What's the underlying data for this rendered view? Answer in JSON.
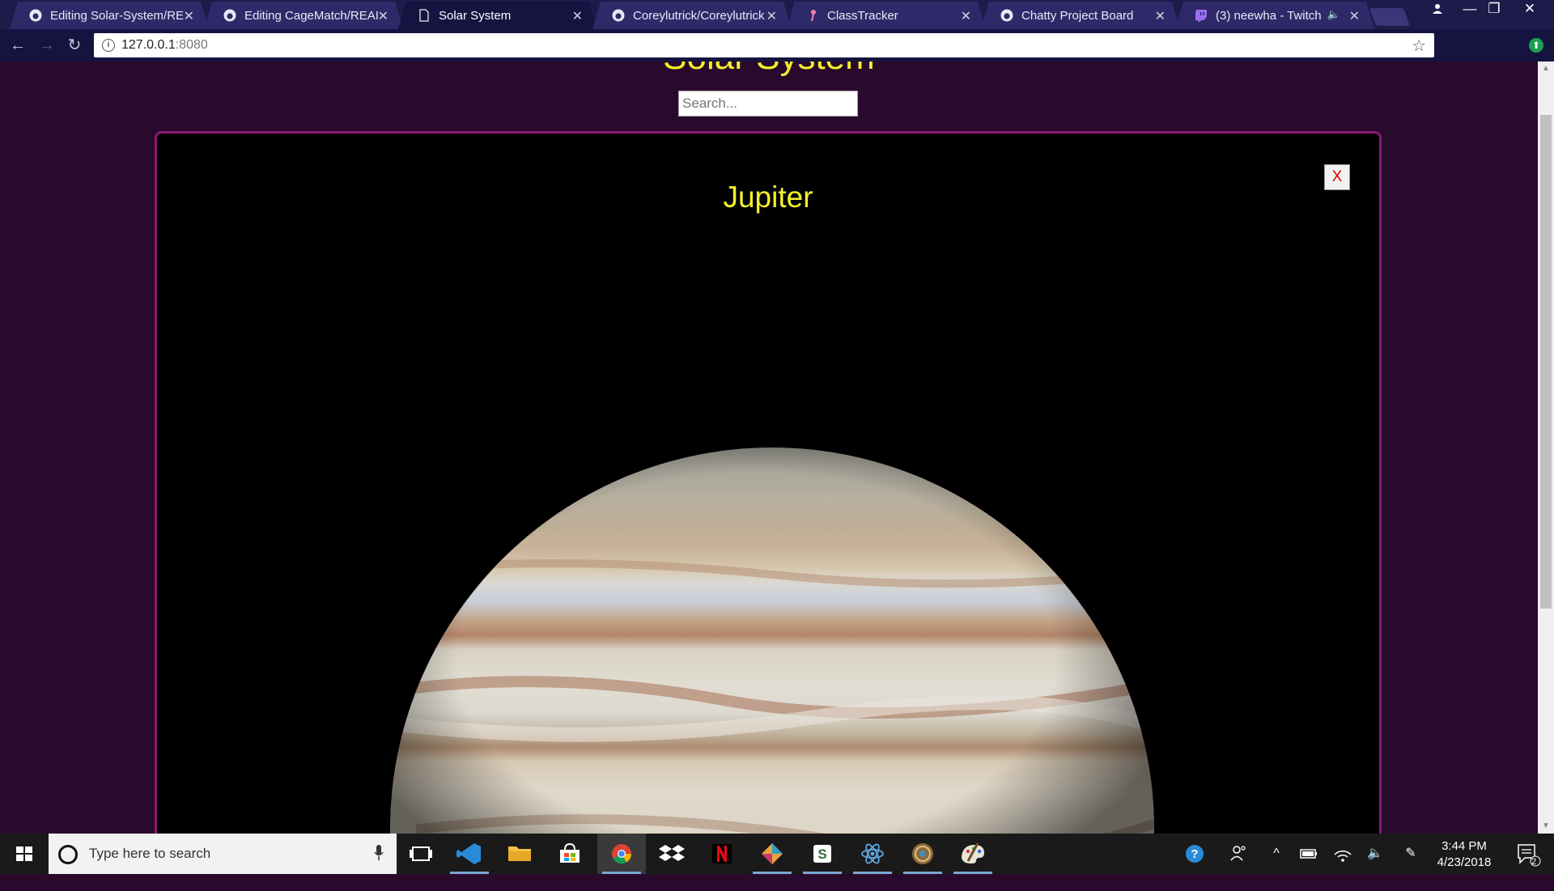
{
  "browser": {
    "tabs": [
      {
        "title": "Editing Solar-System/RE",
        "icon": "github-icon",
        "active": false
      },
      {
        "title": "Editing CageMatch/REAI",
        "icon": "github-icon",
        "active": false
      },
      {
        "title": "Solar System",
        "icon": "document-icon",
        "active": true
      },
      {
        "title": "Coreylutrick/Coreylutrick",
        "icon": "github-icon",
        "active": false
      },
      {
        "title": "ClassTracker",
        "icon": "flamingo-icon",
        "active": false
      },
      {
        "title": "Chatty Project Board",
        "icon": "github-icon",
        "active": false
      },
      {
        "title": "(3) neewha - Twitch",
        "icon": "twitch-icon",
        "active": false,
        "audio": true
      }
    ],
    "url_host": "127.0.0.1",
    "url_port": ":8080"
  },
  "page": {
    "title": "Solar System",
    "search_placeholder": "Search...",
    "modal": {
      "planet_name": "Jupiter",
      "close_label": "X"
    }
  },
  "taskbar": {
    "search_placeholder": "Type here to search",
    "apps": [
      "task-view-icon",
      "vscode-icon",
      "file-explorer-icon",
      "store-icon",
      "chrome-icon",
      "dropbox-icon",
      "netflix-icon",
      "gitkraken-icon",
      "slack-icon",
      "atom-icon",
      "overwatch-icon",
      "paint-icon"
    ],
    "time": "3:44 PM",
    "date": "4/23/2018",
    "notification_count": "2"
  }
}
